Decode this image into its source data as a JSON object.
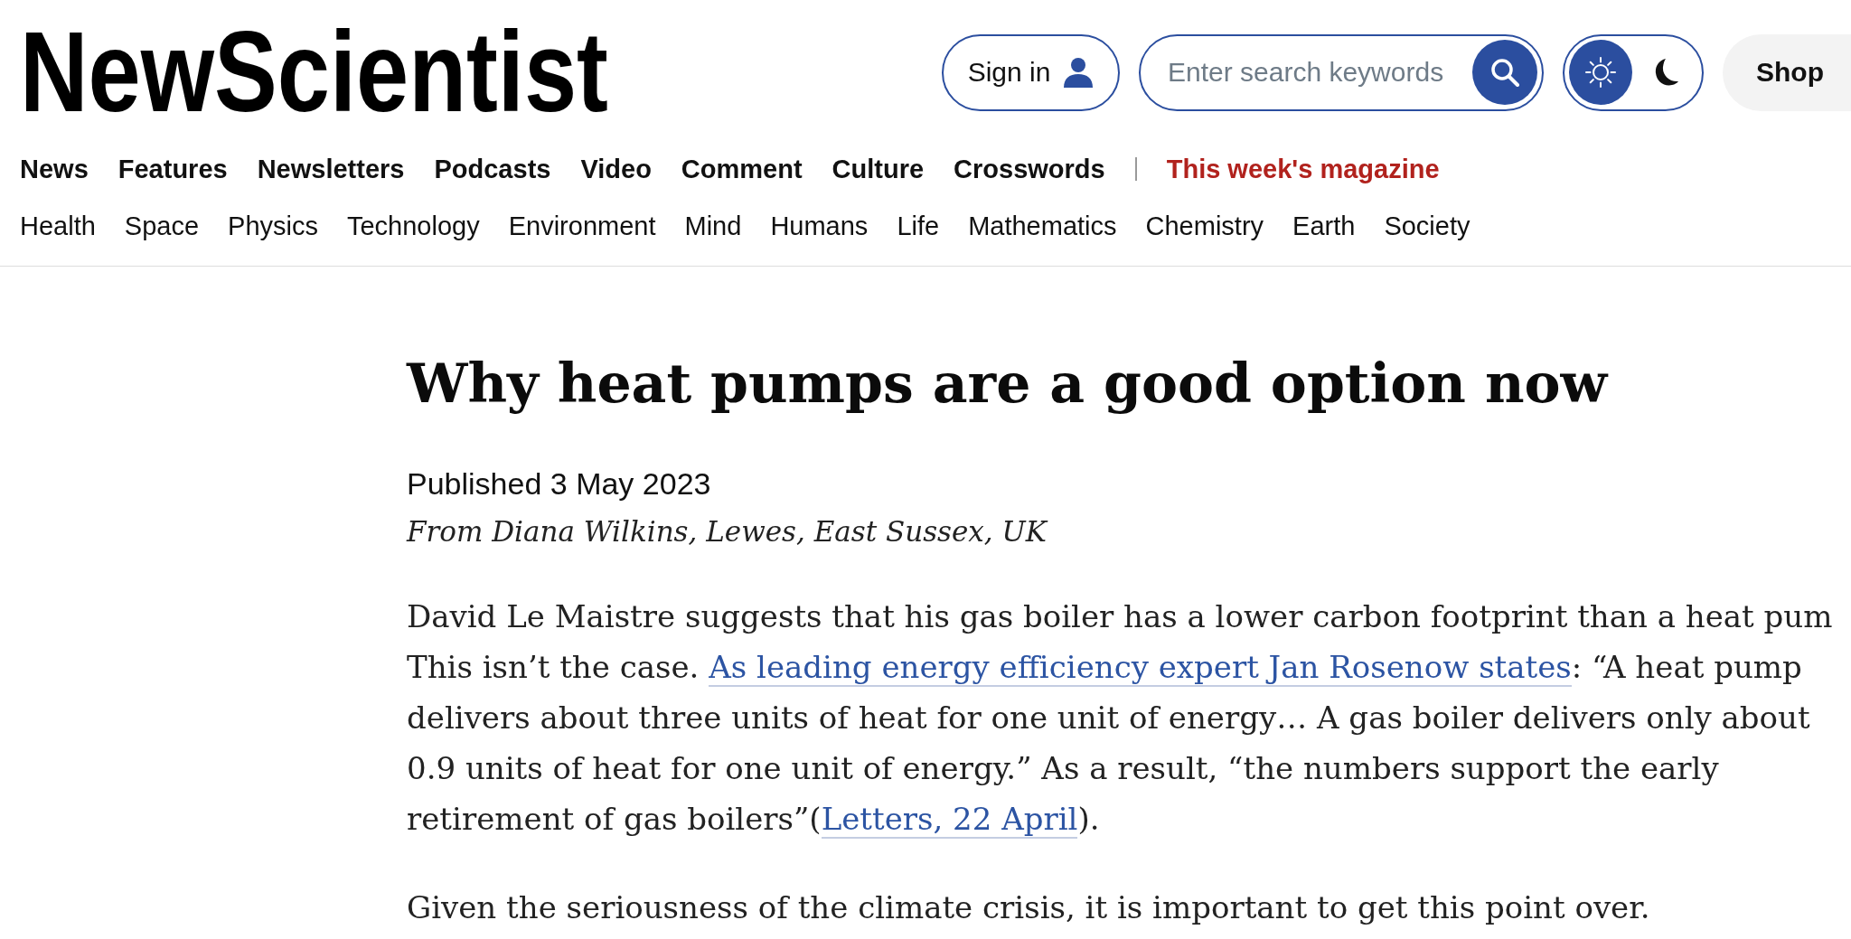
{
  "header": {
    "logo": "NewScientist",
    "sign_in": {
      "label": "Sign in"
    },
    "search": {
      "placeholder": "Enter search keywords"
    },
    "theme_toggle": [
      {
        "kind": "light",
        "selected": true
      },
      {
        "kind": "dark",
        "selected": false
      }
    ],
    "shop": {
      "label": "Shop"
    }
  },
  "primary_nav": [
    {
      "label": "News",
      "kind": "section"
    },
    {
      "label": "Features",
      "kind": "section"
    },
    {
      "label": "Newsletters",
      "kind": "section"
    },
    {
      "label": "Podcasts",
      "kind": "section"
    },
    {
      "label": "Video",
      "kind": "section"
    },
    {
      "label": "Comment",
      "kind": "section"
    },
    {
      "label": "Culture",
      "kind": "section"
    },
    {
      "label": "Crosswords",
      "kind": "section"
    },
    {
      "label": "This week's magazine",
      "kind": "magazine"
    }
  ],
  "topic_nav": [
    "Health",
    "Space",
    "Physics",
    "Technology",
    "Environment",
    "Mind",
    "Humans",
    "Life",
    "Mathematics",
    "Chemistry",
    "Earth",
    "Society"
  ],
  "article": {
    "title": "Why heat pumps are a good option now",
    "published": "Published 3 May 2023",
    "byline": "From Diana Wilkins, Lewes, East Sussex, UK",
    "paragraphs": [
      [
        {
          "kind": "text",
          "text": "David Le Maistre suggests that his gas boiler has a lower carbon footprint than a heat pum\nThis isn’t the case. "
        },
        {
          "kind": "link",
          "text": "As leading energy efficiency expert Jan Rosenow states"
        },
        {
          "kind": "text",
          "text": ": “A heat pump\ndelivers about three units of heat for one unit of energy… A gas boiler delivers only about\n0.9 units of heat for one unit of energy.” As a result, “the numbers support the early\nretirement of gas boilers”("
        },
        {
          "kind": "link",
          "text": "Letters, 22 April"
        },
        {
          "kind": "text",
          "text": ")."
        }
      ],
      [
        {
          "kind": "text",
          "text": "Given the seriousness of the climate crisis, it is important to get this point over."
        }
      ]
    ]
  }
}
